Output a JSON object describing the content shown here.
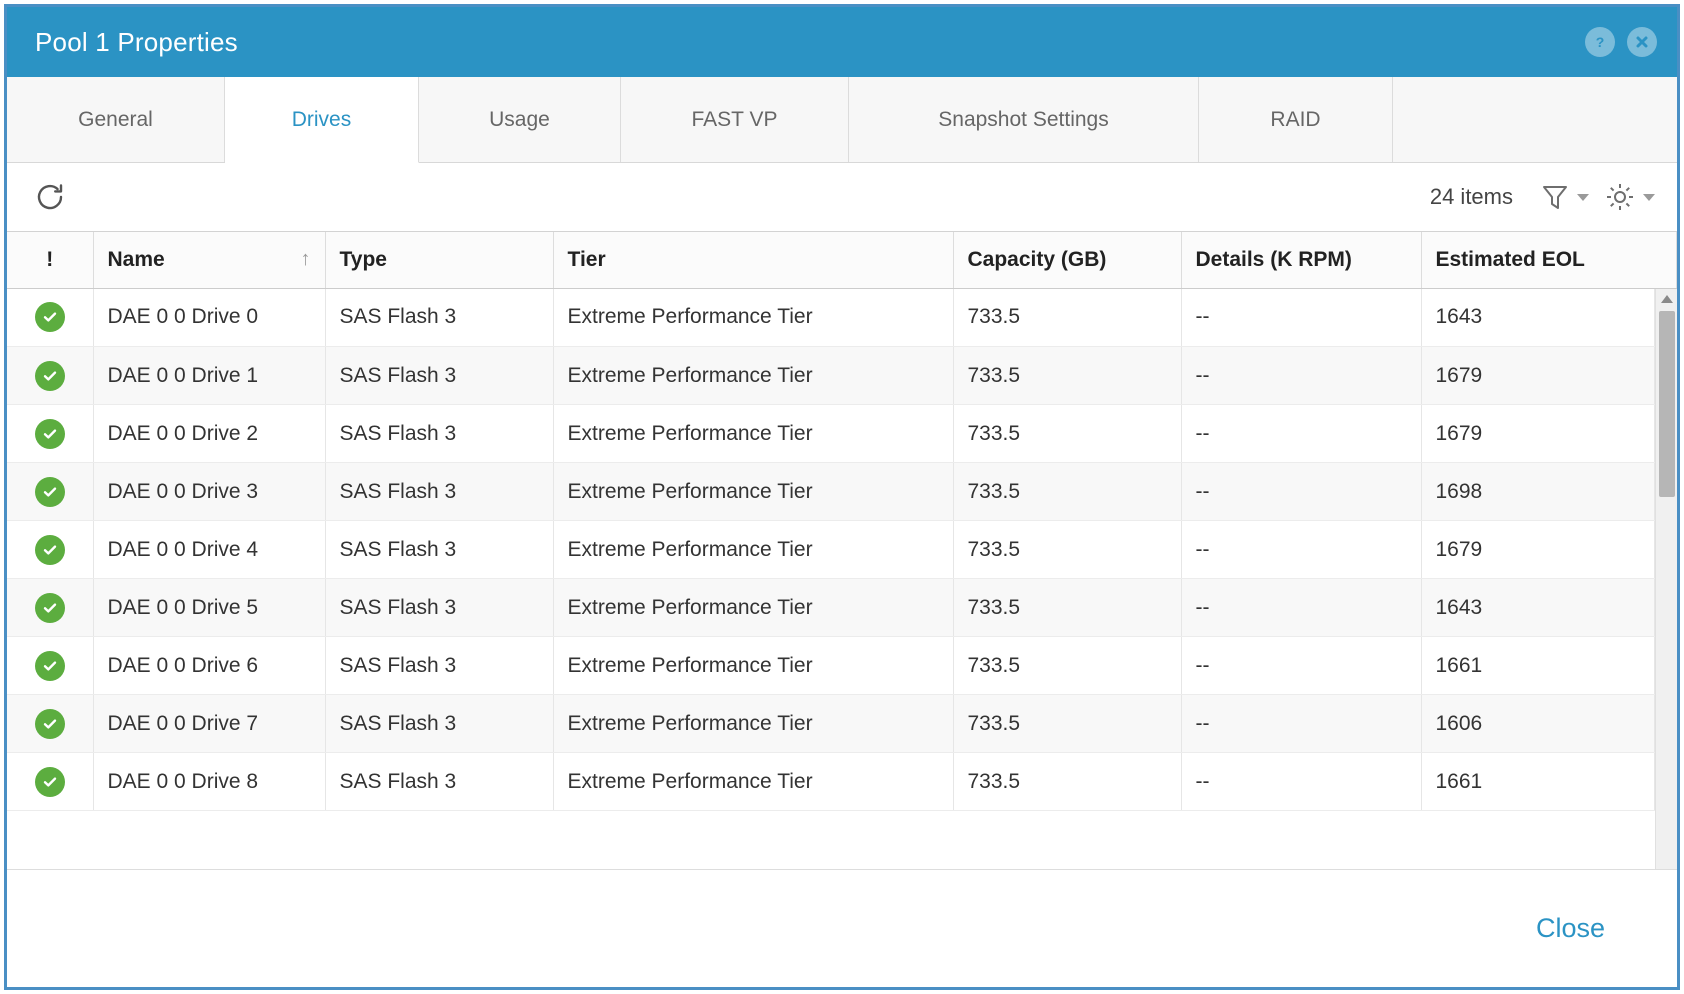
{
  "window": {
    "title": "Pool 1 Properties",
    "help_icon": "help-circle-icon",
    "close_icon": "close-circle-icon",
    "accent_color": "#2b93c4",
    "border_color": "#4a8fc4"
  },
  "tabs": [
    {
      "label": "General",
      "active": false
    },
    {
      "label": "Drives",
      "active": true
    },
    {
      "label": "Usage",
      "active": false
    },
    {
      "label": "FAST VP",
      "active": false
    },
    {
      "label": "Snapshot Settings",
      "active": false
    },
    {
      "label": "RAID",
      "active": false
    }
  ],
  "toolbar": {
    "refresh_icon": "refresh-icon",
    "item_count": "24 items",
    "filter_icon": "filter-funnel-icon",
    "settings_icon": "gear-icon"
  },
  "table": {
    "columns": [
      {
        "key": "flag",
        "label": "!",
        "sorted": false
      },
      {
        "key": "name",
        "label": "Name",
        "sorted": true,
        "sort_dir": "asc",
        "sort_glyph": "↑"
      },
      {
        "key": "type",
        "label": "Type",
        "sorted": false
      },
      {
        "key": "tier",
        "label": "Tier",
        "sorted": false
      },
      {
        "key": "capacity",
        "label": "Capacity (GB)",
        "sorted": false
      },
      {
        "key": "details",
        "label": "Details (K RPM)",
        "sorted": false
      },
      {
        "key": "eol",
        "label": "Estimated EOL",
        "sorted": false
      }
    ],
    "rows": [
      {
        "status": "ok",
        "name": "DAE 0 0 Drive 0",
        "type": "SAS Flash 3",
        "tier": "Extreme Performance Tier",
        "capacity": "733.5",
        "details": "--",
        "eol": "1643"
      },
      {
        "status": "ok",
        "name": "DAE 0 0 Drive 1",
        "type": "SAS Flash 3",
        "tier": "Extreme Performance Tier",
        "capacity": "733.5",
        "details": "--",
        "eol": "1679"
      },
      {
        "status": "ok",
        "name": "DAE 0 0 Drive 2",
        "type": "SAS Flash 3",
        "tier": "Extreme Performance Tier",
        "capacity": "733.5",
        "details": "--",
        "eol": "1679"
      },
      {
        "status": "ok",
        "name": "DAE 0 0 Drive 3",
        "type": "SAS Flash 3",
        "tier": "Extreme Performance Tier",
        "capacity": "733.5",
        "details": "--",
        "eol": "1698"
      },
      {
        "status": "ok",
        "name": "DAE 0 0 Drive 4",
        "type": "SAS Flash 3",
        "tier": "Extreme Performance Tier",
        "capacity": "733.5",
        "details": "--",
        "eol": "1679"
      },
      {
        "status": "ok",
        "name": "DAE 0 0 Drive 5",
        "type": "SAS Flash 3",
        "tier": "Extreme Performance Tier",
        "capacity": "733.5",
        "details": "--",
        "eol": "1643"
      },
      {
        "status": "ok",
        "name": "DAE 0 0 Drive 6",
        "type": "SAS Flash 3",
        "tier": "Extreme Performance Tier",
        "capacity": "733.5",
        "details": "--",
        "eol": "1661"
      },
      {
        "status": "ok",
        "name": "DAE 0 0 Drive 7",
        "type": "SAS Flash 3",
        "tier": "Extreme Performance Tier",
        "capacity": "733.5",
        "details": "--",
        "eol": "1606"
      },
      {
        "status": "ok",
        "name": "DAE 0 0 Drive 8",
        "type": "SAS Flash 3",
        "tier": "Extreme Performance Tier",
        "capacity": "733.5",
        "details": "--",
        "eol": "1661"
      }
    ],
    "status_ok_color": "#5cad3f"
  },
  "scrollbar": {
    "up_arrow_icon": "scroll-up-arrow-icon",
    "thumb": "scrollbar-thumb"
  },
  "footer": {
    "close_label": "Close"
  }
}
